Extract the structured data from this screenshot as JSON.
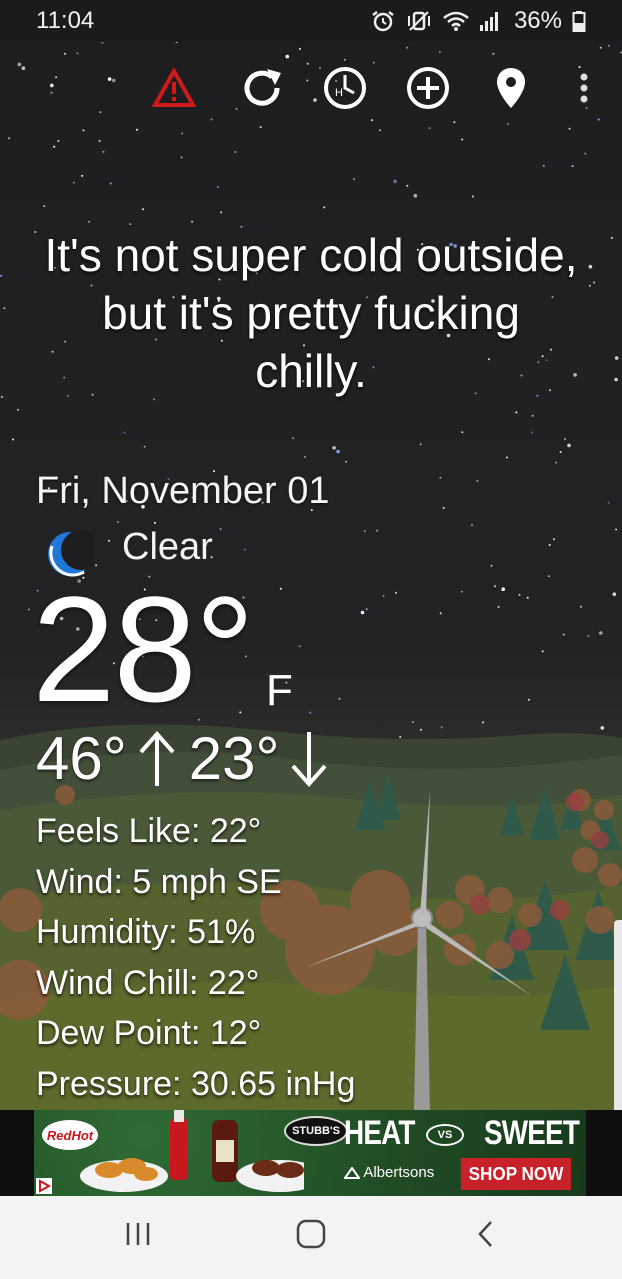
{
  "status_bar": {
    "time": "11:04",
    "battery": "36%",
    "icons": [
      "alarm-icon",
      "vibrate-mute-icon",
      "wifi-icon",
      "signal-icon",
      "battery-icon"
    ]
  },
  "toolbar": {
    "icons": [
      "alert-triangle-icon",
      "refresh-icon",
      "history-clock-icon",
      "add-location-icon",
      "location-pin-icon",
      "overflow-menu-icon"
    ],
    "alert_color": "#d0191b"
  },
  "headline": "It's not super cold outside, but it's pretty fucking chilly.",
  "date": "Fri, November 01",
  "condition": {
    "icon": "crescent-moon-icon",
    "text": "Clear",
    "icon_color": "#1f78d8"
  },
  "temperature": {
    "value": "28°",
    "unit": "F",
    "high": "46°",
    "low": "23°"
  },
  "details": [
    "Feels Like: 22°",
    "Wind: 5 mph SE",
    "Humidity: 51%",
    "Wind Chill: 22°",
    "Dew Point: 12°",
    "Pressure: 30.65 inHg"
  ],
  "ad": {
    "brand_left": "RedHot",
    "brand_mid": "STUBB'S",
    "heat": "HEAT",
    "vs": "VS",
    "sweet": "SWEET",
    "retailer": "Albertsons",
    "cta": "SHOP NOW"
  },
  "navbar": {
    "icons": [
      "recent-apps-icon",
      "home-icon",
      "back-icon"
    ]
  }
}
